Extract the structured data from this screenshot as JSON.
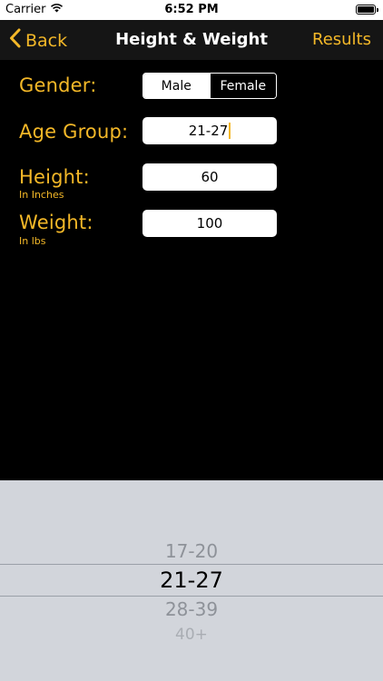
{
  "status_bar": {
    "carrier": "Carrier",
    "time": "6:52 PM",
    "battery_level": 1.0
  },
  "nav": {
    "back_label": "Back",
    "title": "Height & Weight",
    "results_label": "Results"
  },
  "form": {
    "gender": {
      "label": "Gender:",
      "options": [
        "Male",
        "Female"
      ],
      "selected": "Male"
    },
    "age_group": {
      "label": "Age Group:",
      "value": "21-27"
    },
    "height": {
      "label": "Height:",
      "sublabel": "In Inches",
      "value": "60"
    },
    "weight": {
      "label": "Weight:",
      "sublabel": "In lbs",
      "value": "100"
    }
  },
  "picker": {
    "options": [
      "17-20",
      "21-27",
      "28-39",
      "40+"
    ],
    "selected": "21-27"
  },
  "colors": {
    "accent": "#f4b828",
    "background": "#000000",
    "nav_background": "#151515",
    "picker_background": "#d2d5db"
  },
  "icons": {
    "back": "chevron-left-icon",
    "wifi": "wifi-icon",
    "battery": "battery-icon"
  }
}
